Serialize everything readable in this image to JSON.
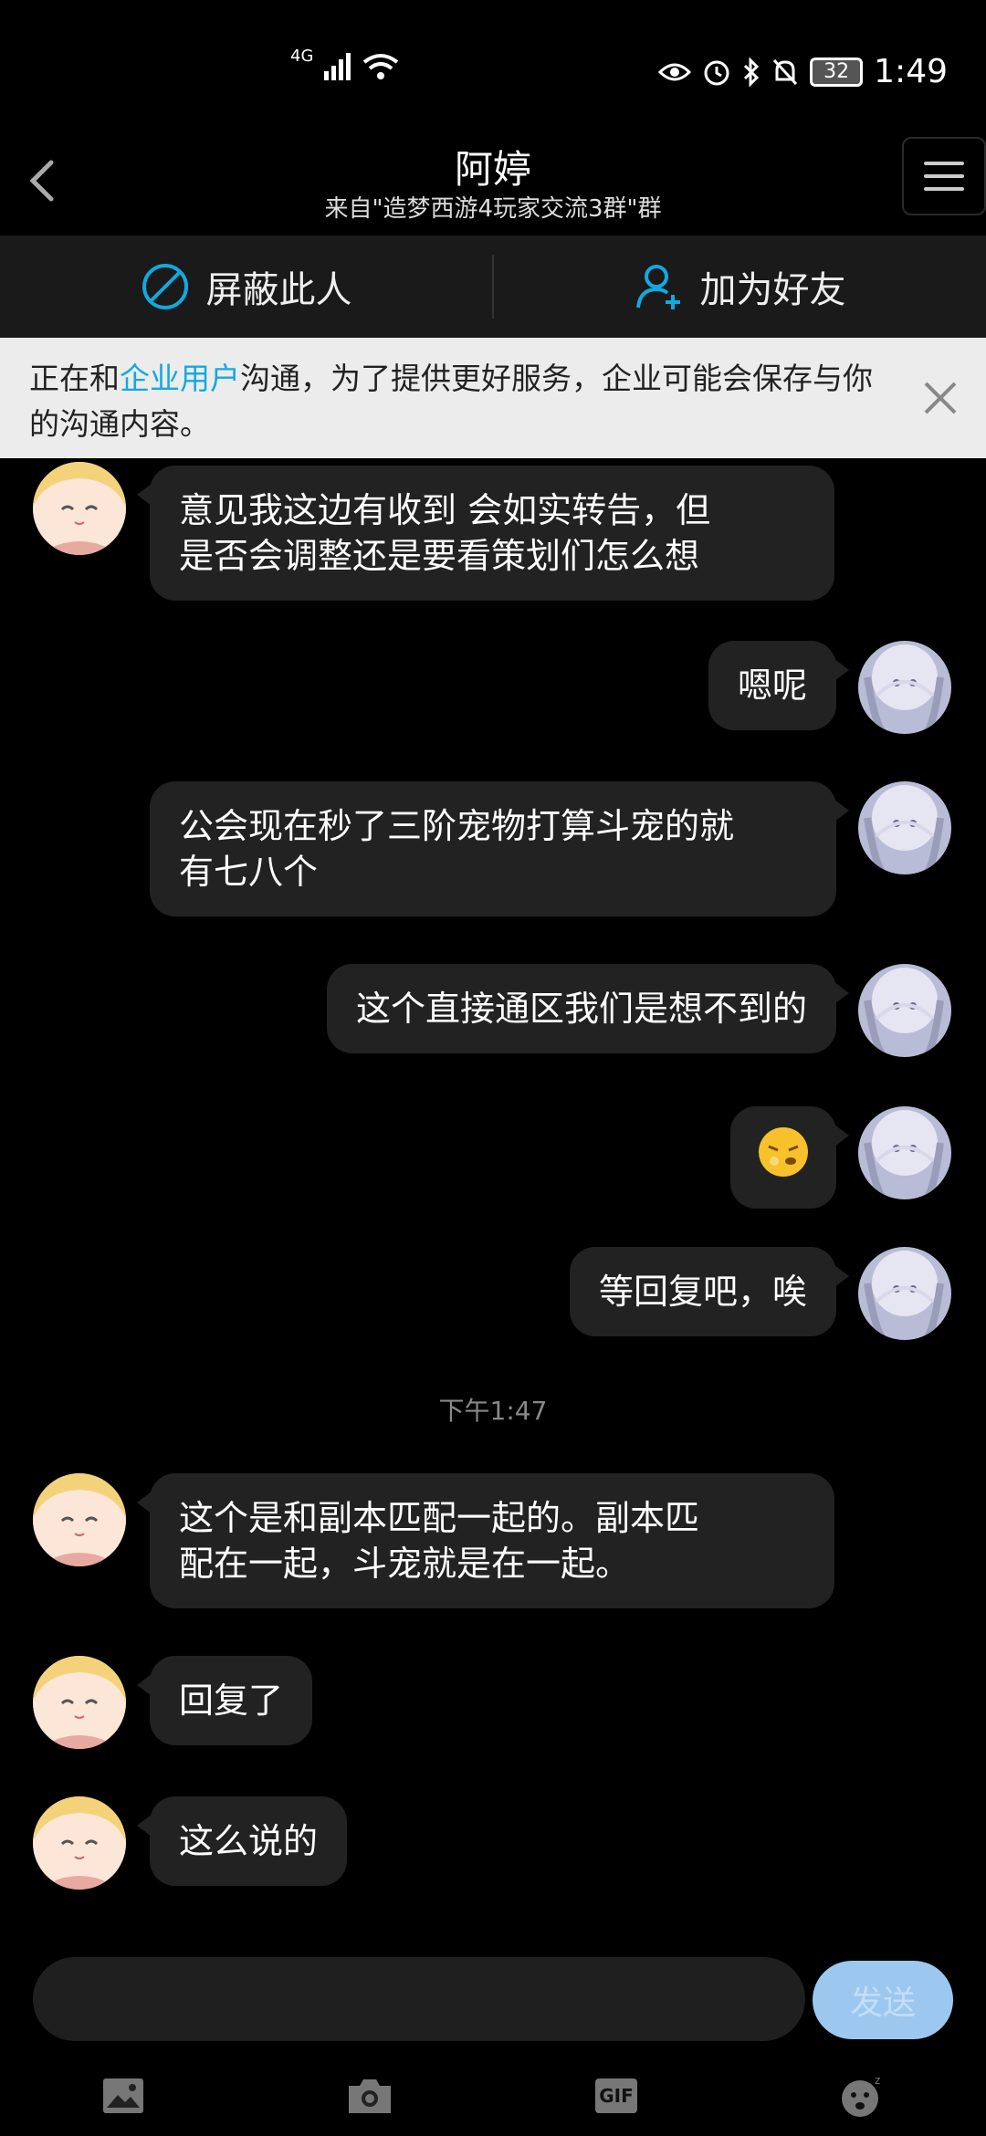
{
  "status_bar": {
    "network": "4G",
    "battery": "32",
    "time": "1:49"
  },
  "header": {
    "title": "阿婷",
    "subtitle": "来自\"造梦西游4玩家交流3群\"群"
  },
  "actions": {
    "block_label": "屏蔽此人",
    "add_friend_label": "加为好友"
  },
  "notice": {
    "prefix": "正在和",
    "link": "企业用户",
    "suffix": "沟通，为了提供更好服务，企业可能会保存与你的沟通内容。"
  },
  "messages": [
    {
      "side": "left",
      "line1": "意见我这边有收到 会如实转告，但",
      "line2": "是否会调整还是要看策划们怎么想"
    },
    {
      "side": "right",
      "text": "嗯呢"
    },
    {
      "side": "right",
      "line1": "公会现在秒了三阶宠物打算斗宠的就",
      "line2": "有七八个"
    },
    {
      "side": "right",
      "text": "这个直接通区我们是想不到的"
    },
    {
      "side": "right",
      "emoji": "emoji-face"
    },
    {
      "side": "right",
      "text": "等回复吧，唉"
    },
    {
      "side": "left",
      "line1": "这个是和副本匹配一起的。副本匹",
      "line2": "配在一起，斗宠就是在一起。"
    },
    {
      "side": "left",
      "text": "回复了"
    },
    {
      "side": "left",
      "text": "这么说的"
    }
  ],
  "timestamp": "下午1:47",
  "input": {
    "send_label": "发送"
  },
  "toolbar": {
    "gif_label": "GIF"
  },
  "colors": {
    "link": "#12a9e0",
    "send_button": "#9cc8f0",
    "bubble": "#222222"
  }
}
